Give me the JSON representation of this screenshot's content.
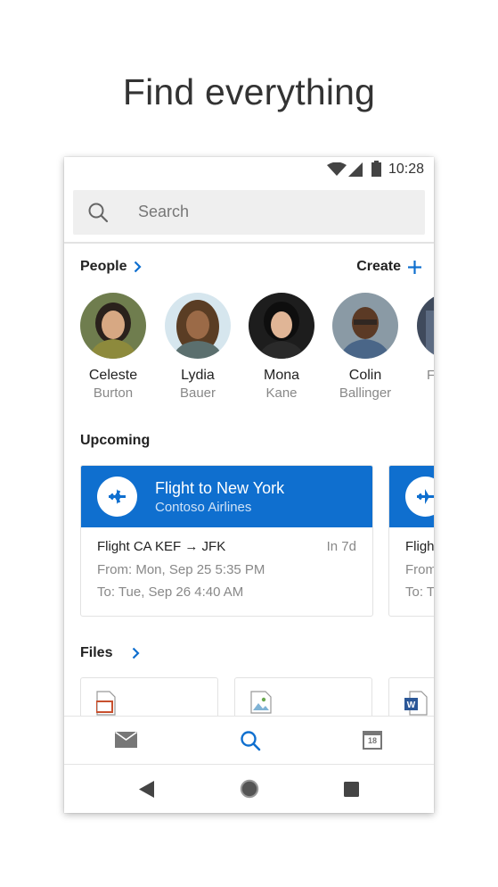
{
  "headline": "Find everything",
  "status": {
    "time": "10:28"
  },
  "search": {
    "placeholder": "Search"
  },
  "people": {
    "title": "People",
    "create_label": "Create",
    "items": [
      {
        "first": "Celeste",
        "last": "Burton"
      },
      {
        "first": "Lydia",
        "last": "Bauer"
      },
      {
        "first": "Mona",
        "last": "Kane"
      },
      {
        "first": "Colin",
        "last": "Ballinger"
      },
      {
        "first": "",
        "last": "F"
      }
    ]
  },
  "upcoming": {
    "title": "Upcoming",
    "cards": [
      {
        "title": "Flight to New York",
        "airline": "Contoso Airlines",
        "route": "Flight CA KEF → JFK",
        "due": "In 7d",
        "from": "From: Mon, Sep 25 5:35 PM",
        "to": "To: Tue, Sep 26 4:40 AM"
      },
      {
        "route": "Fligh",
        "from": "From",
        "to": "To: T"
      }
    ]
  },
  "files": {
    "title": "Files"
  },
  "colors": {
    "accent": "#0f6fcf",
    "muted": "#888888"
  },
  "bottom_nav": [
    "mail-icon",
    "search-icon",
    "calendar-icon"
  ],
  "calendar_day": "18"
}
